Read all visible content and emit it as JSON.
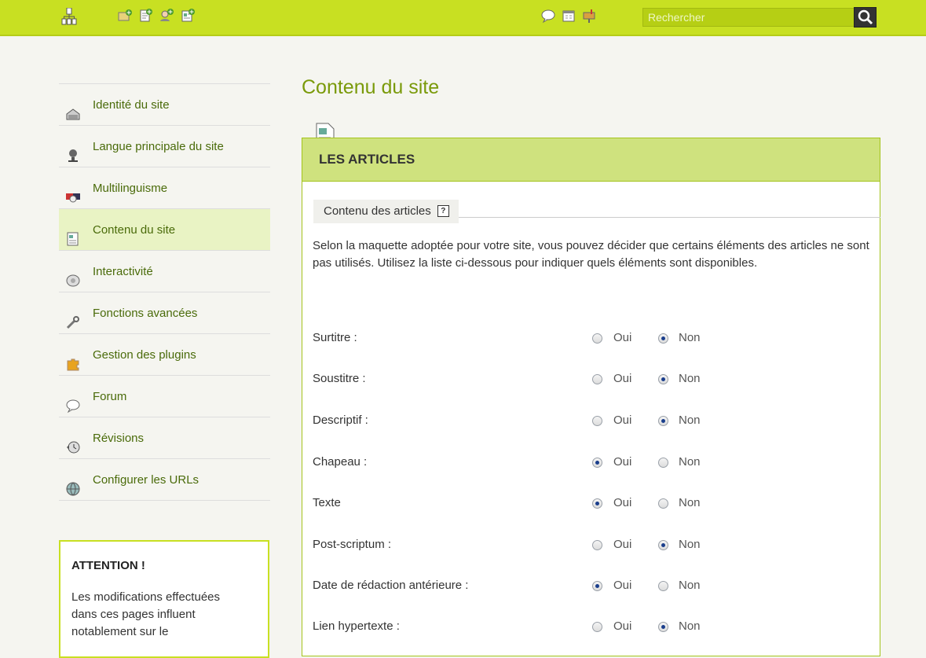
{
  "topbar": {
    "icons": [
      "sitemap-icon",
      "new-folder-icon",
      "new-article-icon",
      "new-author-icon",
      "new-brief-icon",
      "messages-icon",
      "calendar-icon",
      "mailbox-icon"
    ],
    "search_placeholder": "Rechercher",
    "accent": "#c8e022"
  },
  "nav": {
    "items": [
      {
        "label": "Identité du site",
        "icon": "identity-icon",
        "active": false
      },
      {
        "label": "Langue principale du site",
        "icon": "language-icon",
        "active": false
      },
      {
        "label": "Multilinguisme",
        "icon": "multilingual-icon",
        "active": false
      },
      {
        "label": "Contenu du site",
        "icon": "content-icon",
        "active": true
      },
      {
        "label": "Interactivité",
        "icon": "interactivity-icon",
        "active": false
      },
      {
        "label": "Fonctions avancées",
        "icon": "wrench-icon",
        "active": false
      },
      {
        "label": "Gestion des plugins",
        "icon": "plugin-icon",
        "active": false
      },
      {
        "label": "Forum",
        "icon": "forum-icon",
        "active": false
      },
      {
        "label": "Révisions",
        "icon": "revisions-icon",
        "active": false
      },
      {
        "label": "Configurer les URLs",
        "icon": "urls-icon",
        "active": false
      }
    ]
  },
  "attention": {
    "title": "ATTENTION !",
    "lines": [
      "Les modifications effectuées",
      "dans ces pages influent",
      "notablement sur le"
    ]
  },
  "main": {
    "title": "Contenu du site",
    "panel_title": "LES ARTICLES",
    "legend": "Contenu des articles",
    "help": "?",
    "explain": "Selon la maquette adoptée pour votre site, vous pouvez décider que certains éléments des articles ne sont pas utilisés. Utilisez la liste ci-dessous pour indiquer quels éléments sont disponibles.",
    "oui": "Oui",
    "non": "Non",
    "rows": [
      {
        "label": "Surtitre :",
        "value": "Non"
      },
      {
        "label": "Soustitre :",
        "value": "Non"
      },
      {
        "label": "Descriptif :",
        "value": "Non"
      },
      {
        "label": "Chapeau :",
        "value": "Oui"
      },
      {
        "label": "Texte",
        "value": "Oui"
      },
      {
        "label": "Post-scriptum :",
        "value": "Non"
      },
      {
        "label": "Date de rédaction antérieure :",
        "value": "Oui"
      },
      {
        "label": "Lien hypertexte :",
        "value": "Non"
      }
    ]
  }
}
